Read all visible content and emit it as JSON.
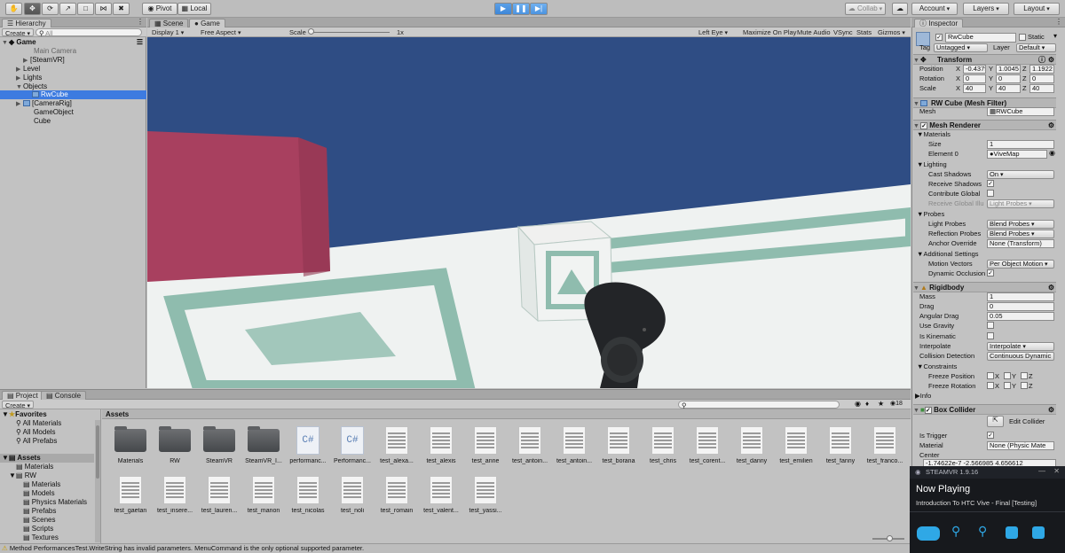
{
  "toolbar": {
    "pivot": "Pivot",
    "local": "Local",
    "collab": "Collab",
    "account": "Account",
    "layers": "Layers",
    "layout": "Layout"
  },
  "hierarchy": {
    "tab": "Hierarchy",
    "create": "Create",
    "search": "All",
    "scene": "Game",
    "items": [
      "Main Camera",
      "[SteamVR]",
      "Level",
      "Lights",
      "Objects",
      "RwCube",
      "[CameraRig]",
      "GameObject",
      "Cube"
    ]
  },
  "game": {
    "scene_tab": "Scene",
    "game_tab": "Game",
    "display": "Display 1",
    "aspect": "Free Aspect",
    "scale_label": "Scale",
    "scale_value": "1x",
    "left_eye": "Left Eye",
    "max_on_play": "Maximize On Play",
    "mute": "Mute Audio",
    "vsync": "VSync",
    "stats": "Stats",
    "gizmos": "Gizmos"
  },
  "inspector": {
    "tab": "Inspector",
    "name": "RwCube",
    "static": "Static",
    "tag_label": "Tag",
    "tag": "Untagged",
    "layer_label": "Layer",
    "layer": "Default",
    "transform": {
      "title": "Transform",
      "position_label": "Position",
      "rotation_label": "Rotation",
      "scale_label": "Scale",
      "position": [
        "-0.4379",
        "1.0045",
        "1.1922"
      ],
      "rotation": [
        "0",
        "0",
        "0"
      ],
      "scale": [
        "40",
        "40",
        "40"
      ]
    },
    "mesh_filter": {
      "title": "RW Cube (Mesh Filter)",
      "mesh_label": "Mesh",
      "mesh": "RWCube"
    },
    "mesh_renderer": {
      "title": "Mesh Renderer",
      "materials": "Materials",
      "size_label": "Size",
      "size": "1",
      "element0_label": "Element 0",
      "element0": "ViveMap",
      "lighting": "Lighting",
      "cast_shadows_label": "Cast Shadows",
      "cast_shadows": "On",
      "receive_shadows": "Receive Shadows",
      "contribute_global": "Contribute Global",
      "receive_global": "Receive Global Illu",
      "receive_global_value": "Light Probes",
      "probes": "Probes",
      "light_probes_label": "Light Probes",
      "light_probes": "Blend Probes",
      "reflection_probes_label": "Reflection Probes",
      "reflection_probes": "Blend Probes",
      "anchor_label": "Anchor Override",
      "anchor": "None (Transform)",
      "additional": "Additional Settings",
      "motion_label": "Motion Vectors",
      "motion": "Per Object Motion",
      "dynamic_occlusion": "Dynamic Occlusion"
    },
    "rigidbody": {
      "title": "Rigidbody",
      "mass_label": "Mass",
      "mass": "1",
      "drag_label": "Drag",
      "drag": "0",
      "angular_label": "Angular Drag",
      "angular": "0.05",
      "gravity": "Use Gravity",
      "kinematic": "Is Kinematic",
      "interpolate_label": "Interpolate",
      "interpolate": "Interpolate",
      "collision_label": "Collision Detection",
      "collision": "Continuous Dynamic",
      "constraints": "Constraints",
      "freeze_pos": "Freeze Position",
      "freeze_rot": "Freeze Rotation",
      "x": "X",
      "y": "Y",
      "z": "Z",
      "info": "Info"
    },
    "box_collider": {
      "title": "Box Collider",
      "edit": "Edit Collider",
      "trigger": "Is Trigger",
      "material_label": "Material",
      "material": "None (Physic Mate",
      "center_label": "Center",
      "center": "-1.74622e-7  -2.566985  4.656612"
    }
  },
  "project": {
    "tab": "Project",
    "console_tab": "Console",
    "create": "Create",
    "favorites": "Favorites",
    "fav_items": [
      "All Materials",
      "All Models",
      "All Prefabs"
    ],
    "assets_root": "Assets",
    "tree": [
      "Materials",
      "RW",
      "Materials",
      "Models",
      "Physics Materials",
      "Prefabs",
      "Scenes",
      "Scripts",
      "Textures"
    ],
    "breadcrumb": "Assets",
    "count": "18",
    "row1": [
      {
        "name": "Materials",
        "kind": "folder"
      },
      {
        "name": "RW",
        "kind": "folder"
      },
      {
        "name": "SteamVR",
        "kind": "folder"
      },
      {
        "name": "SteamVR_I...",
        "kind": "folder"
      },
      {
        "name": "performanc...",
        "kind": "cs"
      },
      {
        "name": "Performanc...",
        "kind": "cs"
      },
      {
        "name": "test_alexa...",
        "kind": "doc"
      },
      {
        "name": "test_alexis",
        "kind": "doc"
      },
      {
        "name": "test_anne",
        "kind": "doc"
      },
      {
        "name": "test_antoin...",
        "kind": "doc"
      },
      {
        "name": "test_antoin...",
        "kind": "doc"
      },
      {
        "name": "test_borana",
        "kind": "doc"
      },
      {
        "name": "test_chris",
        "kind": "doc"
      },
      {
        "name": "test_corent...",
        "kind": "doc"
      },
      {
        "name": "test_danny",
        "kind": "doc"
      },
      {
        "name": "test_emilien",
        "kind": "doc"
      },
      {
        "name": "test_fanny",
        "kind": "doc"
      },
      {
        "name": "test_franco...",
        "kind": "doc"
      }
    ],
    "row2": [
      {
        "name": "test_gaetan",
        "kind": "doc"
      },
      {
        "name": "test_insere...",
        "kind": "doc"
      },
      {
        "name": "test_lauren...",
        "kind": "doc"
      },
      {
        "name": "test_manon",
        "kind": "doc"
      },
      {
        "name": "test_nicolas",
        "kind": "doc"
      },
      {
        "name": "test_noli",
        "kind": "doc"
      },
      {
        "name": "test_romain",
        "kind": "doc"
      },
      {
        "name": "test_valent...",
        "kind": "doc"
      },
      {
        "name": "test_yassi...",
        "kind": "doc"
      }
    ]
  },
  "status": {
    "message": "Method PerformancesTest.WriteString has invalid parameters. MenuCommand is the only optional supported parameter."
  },
  "steamvr": {
    "title": "STEAMVR 1.9.16",
    "now_playing": "Now Playing",
    "app": "Introduction To HTC Vive - Final [Testing]"
  }
}
